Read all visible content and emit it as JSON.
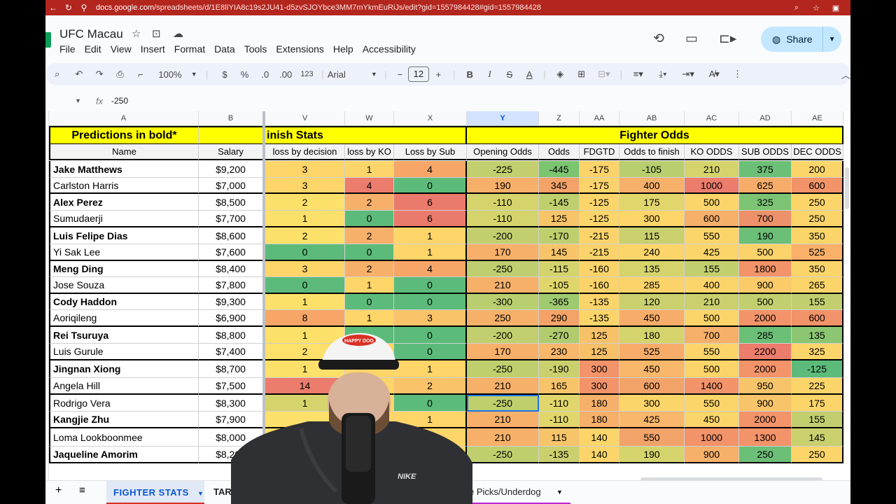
{
  "browser": {
    "url_host": "docs.google.com",
    "url_path": "/spreadsheets/d/1E8lIYIA8c19s2JU41-d5zvSJOYbce3MM7mYkmEuRiJs/edit?gid=1557984428#gid=1557984428"
  },
  "doc": {
    "title": "UFC Macau",
    "share_label": "Share",
    "menu": [
      "File",
      "Edit",
      "View",
      "Insert",
      "Format",
      "Data",
      "Tools",
      "Extensions",
      "Help",
      "Accessibility"
    ]
  },
  "toolbar": {
    "zoom": "100%",
    "currency": "$",
    "percent": "%",
    "dec_decrease": ".0",
    "dec_increase": ".00",
    "number_format": "123",
    "font": "Arial",
    "font_size": "12",
    "bold": "B",
    "italic": "I",
    "strike": "S",
    "text_color": "A"
  },
  "formula_bar": {
    "fx": "fx",
    "value": "-250"
  },
  "columns": [
    "A",
    "B",
    "V",
    "W",
    "X",
    "Y",
    "Z",
    "AA",
    "AB",
    "AC",
    "AD",
    "AE"
  ],
  "header_row": {
    "predictions": "Predictions in bold*",
    "finish_stats": "inish Stats",
    "fighter_odds": "Fighter Odds"
  },
  "subheaders": [
    "Name",
    "Salary",
    "loss by decision",
    "loss by KO",
    "Loss by Sub",
    "Opening Odds",
    "Odds",
    "FDGTD",
    "Odds to finish",
    "KO ODDS",
    "SUB ODDS",
    "DEC ODDS"
  ],
  "rows": [
    {
      "name": "Jake Matthews",
      "bold": true,
      "salary": "$9,200",
      "vals": [
        "3",
        "1",
        "4",
        "-225",
        "-445",
        "-175",
        "-105",
        "210",
        "375",
        "200"
      ]
    },
    {
      "name": "Carlston Harris",
      "bold": false,
      "salary": "$7,000",
      "vals": [
        "3",
        "4",
        "0",
        "190",
        "345",
        "-175",
        "400",
        "1000",
        "625",
        "600"
      ]
    },
    {
      "name": "Alex Perez",
      "bold": true,
      "salary": "$8,500",
      "vals": [
        "2",
        "2",
        "6",
        "-110",
        "-145",
        "-125",
        "175",
        "500",
        "325",
        "250"
      ]
    },
    {
      "name": "Sumudaerji",
      "bold": false,
      "salary": "$7,700",
      "vals": [
        "1",
        "0",
        "6",
        "-110",
        "125",
        "-125",
        "300",
        "600",
        "700",
        "250"
      ]
    },
    {
      "name": "Luis Felipe Dias",
      "bold": true,
      "salary": "$8,600",
      "vals": [
        "2",
        "2",
        "1",
        "-200",
        "-170",
        "-215",
        "115",
        "550",
        "190",
        "350"
      ]
    },
    {
      "name": "Yi Sak Lee",
      "bold": false,
      "salary": "$7,600",
      "vals": [
        "0",
        "0",
        "1",
        "170",
        "145",
        "-215",
        "240",
        "425",
        "500",
        "525"
      ]
    },
    {
      "name": "Meng Ding",
      "bold": true,
      "salary": "$8,400",
      "vals": [
        "3",
        "2",
        "4",
        "-250",
        "-115",
        "-160",
        "135",
        "155",
        "1800",
        "350"
      ]
    },
    {
      "name": "Jose Souza",
      "bold": false,
      "salary": "$7,800",
      "vals": [
        "0",
        "1",
        "0",
        "210",
        "-105",
        "-160",
        "285",
        "400",
        "900",
        "265"
      ]
    },
    {
      "name": "Cody Haddon",
      "bold": true,
      "salary": "$9,300",
      "vals": [
        "1",
        "0",
        "0",
        "-300",
        "-365",
        "-135",
        "120",
        "210",
        "500",
        "155"
      ]
    },
    {
      "name": "Aoriqileng",
      "bold": false,
      "salary": "$6,900",
      "vals": [
        "8",
        "1",
        "3",
        "250",
        "290",
        "-135",
        "450",
        "500",
        "2000",
        "600"
      ]
    },
    {
      "name": "Rei Tsuruya",
      "bold": true,
      "salary": "$8,800",
      "vals": [
        "1",
        "",
        "0",
        "-200",
        "-270",
        "125",
        "180",
        "700",
        "285",
        "135"
      ]
    },
    {
      "name": "Luis Gurule",
      "bold": false,
      "salary": "$7,400",
      "vals": [
        "2",
        "",
        "0",
        "170",
        "230",
        "125",
        "525",
        "550",
        "2200",
        "325"
      ]
    },
    {
      "name": "Jingnan Xiong",
      "bold": true,
      "salary": "$8,700",
      "vals": [
        "1",
        "",
        "1",
        "-250",
        "-190",
        "300",
        "450",
        "500",
        "2000",
        "-125"
      ]
    },
    {
      "name": "Angela Hill",
      "bold": false,
      "salary": "$7,500",
      "vals": [
        "14",
        "",
        "2",
        "210",
        "165",
        "300",
        "600",
        "1400",
        "950",
        "225"
      ]
    },
    {
      "name": "Rodrigo Vera",
      "bold": false,
      "salary": "$8,300",
      "vals": [
        "1",
        "",
        "0",
        "-250",
        "-110",
        "180",
        "300",
        "550",
        "900",
        "175"
      ]
    },
    {
      "name": "Kangjie Zhu",
      "bold": true,
      "salary": "$7,900",
      "vals": [
        "",
        "",
        "1",
        "210",
        "-110",
        "180",
        "425",
        "450",
        "2000",
        "155"
      ]
    },
    {
      "name": "Loma Lookboonmee",
      "bold": false,
      "salary": "$8,000",
      "vals": [
        "",
        "",
        "",
        "210",
        "115",
        "140",
        "550",
        "1000",
        "1300",
        "145"
      ]
    },
    {
      "name": "Jaqueline Amorim",
      "bold": true,
      "salary": "$8,200",
      "vals": [
        "",
        "",
        "",
        "-250",
        "-135",
        "140",
        "190",
        "900",
        "250",
        "250"
      ]
    }
  ],
  "colors": [
    [
      "#fdd568",
      "#fcd56a",
      "#f7a667",
      "#c3cf6e",
      "#7bc470",
      "#fbd36a",
      "#b9cf6f",
      "#d5d46c",
      "#6cbf76",
      "#fcd56a"
    ],
    [
      "#fdd568",
      "#ec7c6c",
      "#5cbb7a",
      "#f7b06a",
      "#f4a268",
      "#fbd36a",
      "#f7b06a",
      "#ec7c6c",
      "#f7ad69",
      "#f29369"
    ],
    [
      "#fde069",
      "#f7b06a",
      "#ea7a6b",
      "#d5d46c",
      "#c0cf6e",
      "#fcd56a",
      "#e1d66b",
      "#fcd56a",
      "#7cc473",
      "#fcd56a"
    ],
    [
      "#fde069",
      "#5cbb7a",
      "#ea7a6b",
      "#d5d46c",
      "#f8c469",
      "#fcd56a",
      "#fdd568",
      "#f7b06a",
      "#ec9169",
      "#fcd56a"
    ],
    [
      "#fde069",
      "#f7b06a",
      "#fdd568",
      "#c3cf6e",
      "#c0cf6e",
      "#fbd36a",
      "#c9d06d",
      "#fcd56a",
      "#6cbf76",
      "#fcd56a"
    ],
    [
      "#5cbb7a",
      "#5cbb7a",
      "#fdd568",
      "#f7b06a",
      "#f8c469",
      "#fbd36a",
      "#fcd56a",
      "#fcd56a",
      "#fbd36a",
      "#fbb06a"
    ],
    [
      "#fdd568",
      "#f7b06a",
      "#f7a667",
      "#bfce6f",
      "#d5d46c",
      "#fbd36a",
      "#d5d46c",
      "#c3cf6e",
      "#f29369",
      "#fcd56a"
    ],
    [
      "#5cbb7a",
      "#fdd568",
      "#5cbb7a",
      "#f7b06a",
      "#e1d66b",
      "#fbd36a",
      "#fbd36a",
      "#fcd56a",
      "#fbcb69",
      "#fcd56a"
    ],
    [
      "#fde069",
      "#5cbb7a",
      "#5cbb7a",
      "#b9cf6f",
      "#9fca70",
      "#fcd56a",
      "#c9d06d",
      "#c9d06d",
      "#c3cf6e",
      "#c3cf6e"
    ],
    [
      "#f7a667",
      "#fdd568",
      "#fbc369",
      "#f7b06a",
      "#f4a268",
      "#fcd56a",
      "#f7ad69",
      "#fcd56a",
      "#f29369",
      "#f29369"
    ],
    [
      "#fde069",
      "#5cbb7a",
      "#5cbb7a",
      "#c3cf6e",
      "#b0cc6f",
      "#f7c169",
      "#d5d46c",
      "#f7b06a",
      "#6cbf76",
      "#8cc672"
    ],
    [
      "#fde069",
      "#fdd568",
      "#5cbb7a",
      "#f7b06a",
      "#f8b76a",
      "#f7c169",
      "#f7ad69",
      "#fcd56a",
      "#ec7c6c",
      "#fcd56a"
    ],
    [
      "#fde069",
      "#fdd568",
      "#fdd568",
      "#c0cf6e",
      "#c9d06d",
      "#f29369",
      "#f8b76a",
      "#fcd56a",
      "#f29369",
      "#5cbb7a"
    ],
    [
      "#ec7c6c",
      "#fdd568",
      "#fbc369",
      "#f7b06a",
      "#f8c469",
      "#f29369",
      "#f2a369",
      "#f29369",
      "#f8c469",
      "#fcd56a"
    ],
    [
      "#d5d46c",
      "#fdd568",
      "#5cbb7a",
      "#c0cf6e",
      "#e1d66b",
      "#f7b06a",
      "#fcd56a",
      "#fcd56a",
      "#f8c469",
      "#fcd56a"
    ],
    [
      "#fde069",
      "#fdd568",
      "#fdd568",
      "#f7b06a",
      "#e1d66b",
      "#f7b06a",
      "#f8b76a",
      "#fcd56a",
      "#f29369",
      "#c3cf6e"
    ],
    [
      "#fde069",
      "#fdd568",
      "#fdd568",
      "#f7b06a",
      "#f8c469",
      "#fcd56a",
      "#f2a369",
      "#f29369",
      "#f29369",
      "#c9d06d"
    ],
    [
      "#fde069",
      "#fdd568",
      "#fdd568",
      "#c0cf6e",
      "#c9d06d",
      "#fcd56a",
      "#d5d46c",
      "#f7b06a",
      "#6cbf76",
      "#fcd56a"
    ]
  ],
  "tabs": {
    "active": "FIGHTER STATS",
    "second": "TAR",
    "right": "e Picks/Underdog"
  },
  "cam": {
    "cap_text": "HAPPY DOG",
    "shirt_logo": "NIKE"
  }
}
